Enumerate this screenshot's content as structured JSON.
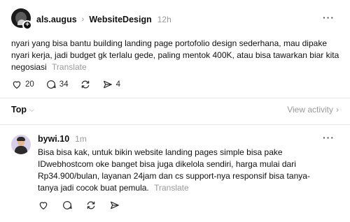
{
  "post": {
    "username": "als.augus",
    "community": "WebsiteDesign",
    "time": "12h",
    "text": "nyari yang bisa bantu building landing page portofolio design sederhana, mau dipake nyari kerja, jadi budget gk terlalu gede, paling mentok 400K, atau bisa tawarkan biar kita negosiasi",
    "translate": "Translate",
    "likes": "20",
    "comments": "34",
    "shares": "4"
  },
  "sort": {
    "label": "Top",
    "view_activity": "View activity"
  },
  "reply": {
    "username": "bywi.10",
    "time": "1m",
    "text": "Bisa bisa kak, untuk bikin website landing pages simple bisa pake IDwebhostcom oke banget bisa juga dikelola sendiri, harga mulai dari Rp34.900/bulan, layanan 24jam dan cs support-nya responsif bisa tanya-tanya jadi cocok buat pemula.",
    "translate": "Translate"
  },
  "icons": {
    "like": "heart-icon",
    "comment": "comment-icon",
    "repost": "repost-icon",
    "share": "send-icon",
    "more": "more-icon"
  }
}
